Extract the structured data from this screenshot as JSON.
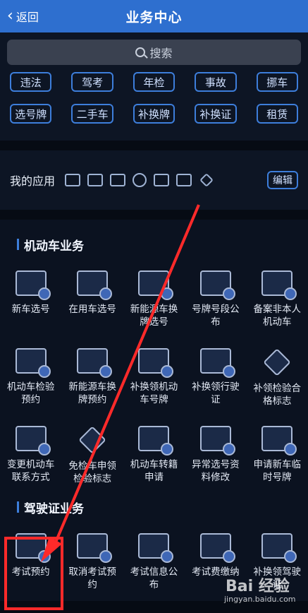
{
  "header": {
    "back_label": "返回",
    "title": "业务中心"
  },
  "search": {
    "placeholder": "搜索"
  },
  "tags": [
    "违法",
    "驾考",
    "年检",
    "事故",
    "挪车",
    "选号牌",
    "二手车",
    "补换牌",
    "补换证",
    "租赁"
  ],
  "apps": {
    "label": "我的应用",
    "edit_label": "编辑"
  },
  "vehicle": {
    "title": "机动车业务",
    "items": [
      "新车选号",
      "在用车选号",
      "新能源车换牌选号",
      "号牌号段公布",
      "备案非本人机动车",
      "机动车检验预约",
      "新能源车换牌预约",
      "补换领机动车号牌",
      "补换领行驶证",
      "补领检验合格标志",
      "变更机动车联系方式",
      "免检车申领检验标志",
      "机动车转籍申请",
      "异常选号资料修改",
      "申请新车临时号牌"
    ]
  },
  "license": {
    "title": "驾驶证业务",
    "items": [
      "考试预约",
      "取消考试预约",
      "考试信息公布",
      "考试费缴纳",
      "补换领驾驶证"
    ]
  },
  "watermark": {
    "text": "Bai 经验",
    "sub": "jingyan.baidu.com"
  },
  "colors": {
    "header": "#2e6fcf",
    "accent": "#3d7edb",
    "highlight": "#ff2a2a"
  }
}
